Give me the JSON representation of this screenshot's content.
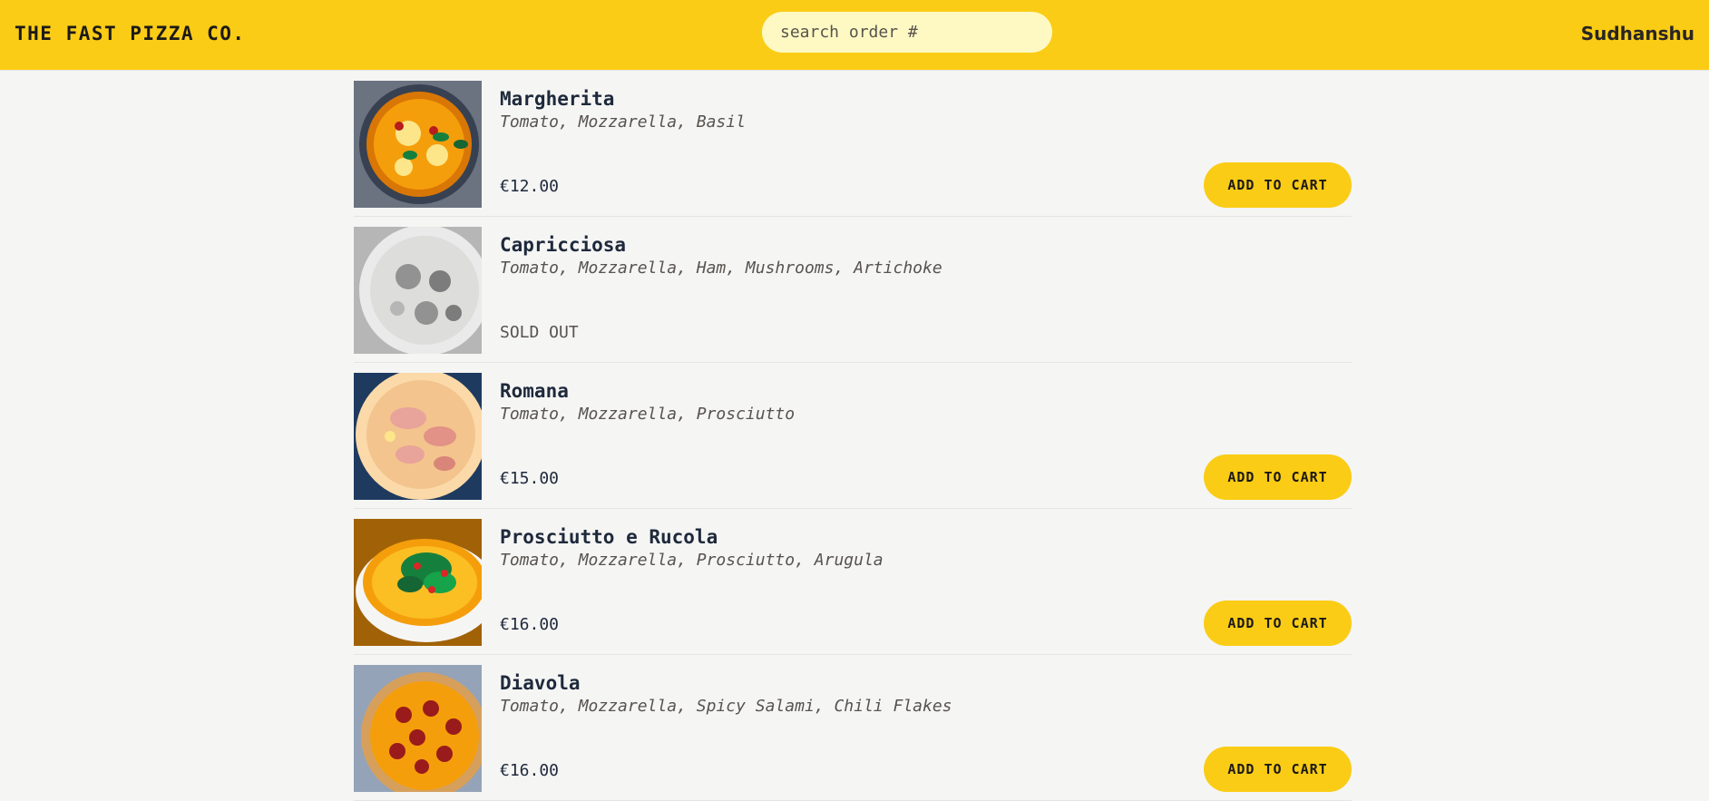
{
  "header": {
    "logo": "THE FAST PIZZA CO.",
    "search_placeholder": "search order #",
    "username": "Sudhanshu"
  },
  "menu": {
    "add_to_cart_label": "ADD TO CART",
    "sold_out_label": "SOLD OUT",
    "items": [
      {
        "name": "Margherita",
        "ingredients": "Tomato, Mozzarella, Basil",
        "price": "€12.00",
        "sold_out": false
      },
      {
        "name": "Capricciosa",
        "ingredients": "Tomato, Mozzarella, Ham, Mushrooms, Artichoke",
        "price": "",
        "sold_out": true
      },
      {
        "name": "Romana",
        "ingredients": "Tomato, Mozzarella, Prosciutto",
        "price": "€15.00",
        "sold_out": false
      },
      {
        "name": "Prosciutto e Rucola",
        "ingredients": "Tomato, Mozzarella, Prosciutto, Arugula",
        "price": "€16.00",
        "sold_out": false
      },
      {
        "name": "Diavola",
        "ingredients": "Tomato, Mozzarella, Spicy Salami, Chili Flakes",
        "price": "€16.00",
        "sold_out": false
      }
    ]
  },
  "colors": {
    "accent": "#facc15",
    "search_bg": "#fef9c3",
    "page_bg": "#f5f5f4"
  }
}
